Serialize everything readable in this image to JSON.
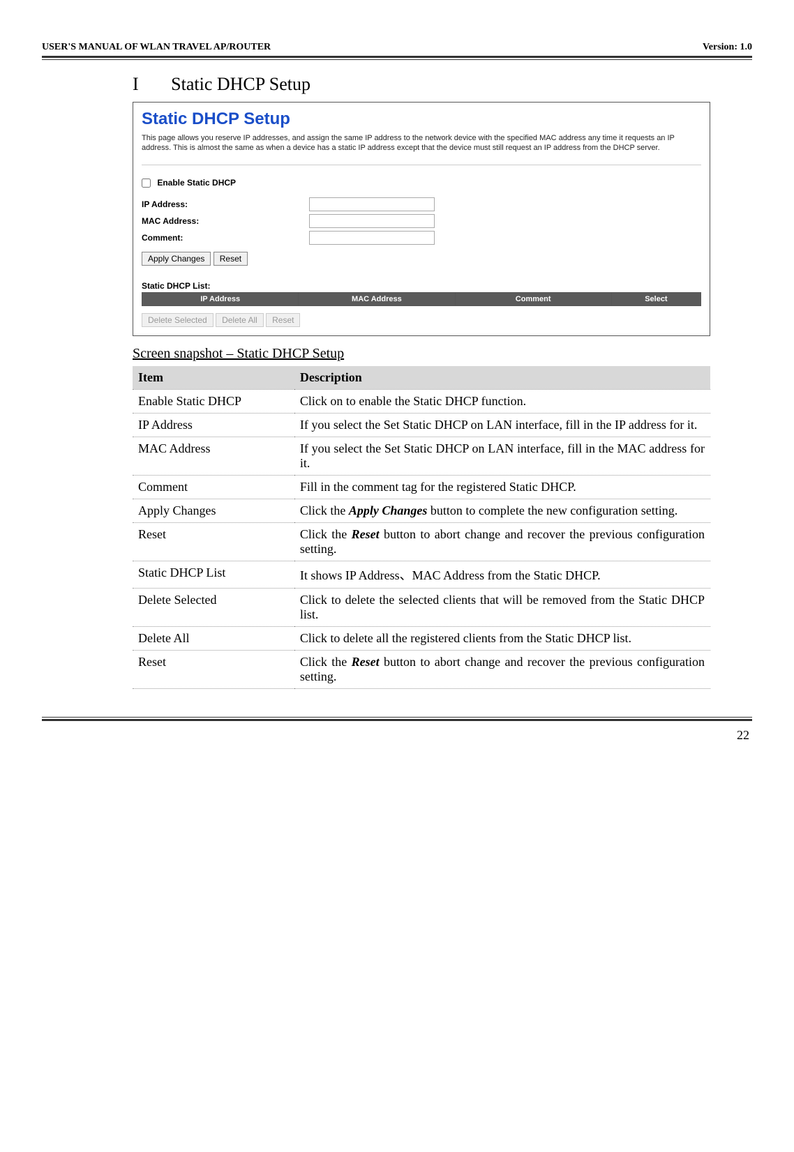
{
  "header": {
    "left": "USER'S MANUAL OF WLAN TRAVEL AP/ROUTER",
    "right": "Version: 1.0"
  },
  "section": {
    "roman": "I",
    "title": "Static DHCP Setup"
  },
  "screenshot": {
    "title": "Static DHCP Setup",
    "description": "This page allows you reserve IP addresses, and assign the same IP address to the network device with the specified MAC address any time it requests an IP address. This is almost the same as when a device has a static IP address except that the device must still request an IP address from the DHCP server.",
    "enable_label": "Enable Static DHCP",
    "fields": {
      "ip": "IP Address:",
      "mac": "MAC Address:",
      "comment": "Comment:"
    },
    "buttons": {
      "apply": "Apply Changes",
      "reset": "Reset",
      "del_sel": "Delete Selected",
      "del_all": "Delete All",
      "reset2": "Reset"
    },
    "list_title": "Static DHCP List:",
    "table_headers": {
      "ip": "IP Address",
      "mac": "MAC Address",
      "comment": "Comment",
      "select": "Select"
    }
  },
  "caption": "Screen snapshot – Static DHCP Setup",
  "table": {
    "h_item": "Item",
    "h_desc": "Description",
    "rows": [
      {
        "item": "Enable Static DHCP",
        "desc": "Click on to enable the Static DHCP function."
      },
      {
        "item": "IP Address",
        "desc": "If you select the Set Static DHCP on LAN interface, fill in the IP address for it."
      },
      {
        "item": "MAC Address",
        "desc": "If you select the Set Static DHCP on LAN interface, fill in the MAC address for it."
      },
      {
        "item": "Comment",
        "desc": "Fill in the comment tag for the registered Static DHCP."
      },
      {
        "item": "Apply Changes",
        "desc": "Click the <b><i>Apply Changes</i></b> button to complete the new configuration setting."
      },
      {
        "item": "Reset",
        "desc": "Click the <b><i>Reset</i></b> button to abort change and recover the previous configuration setting."
      },
      {
        "item": "Static DHCP List",
        "desc": "It shows IP Address、MAC Address from the Static DHCP."
      },
      {
        "item": "Delete Selected",
        "desc": "Click to delete the selected clients that will be removed from the Static DHCP list."
      },
      {
        "item": "Delete All",
        "desc": "Click to delete all the registered clients from the Static DHCP list."
      },
      {
        "item": "Reset",
        "desc": "Click the <b><i>Reset</i></b> button to abort change and recover the previous configuration setting."
      }
    ]
  },
  "page_number": "22"
}
